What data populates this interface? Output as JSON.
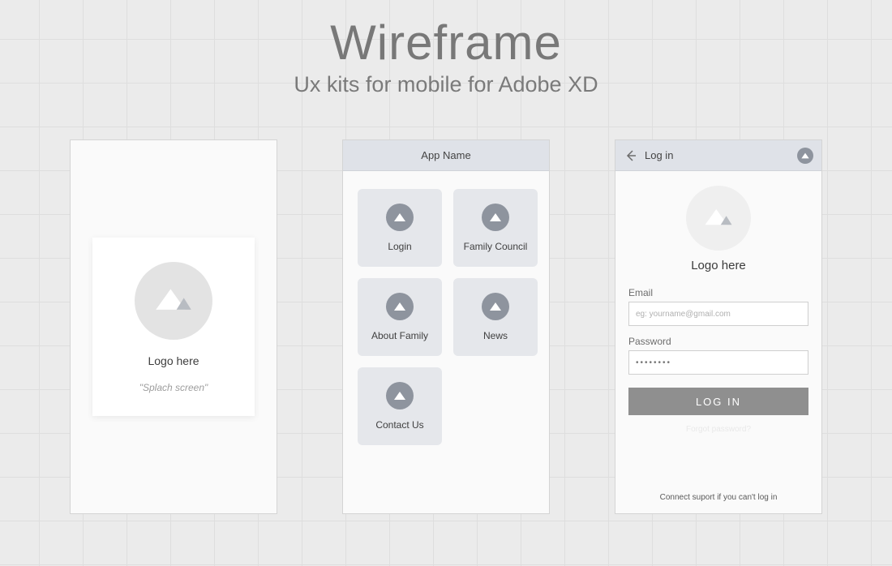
{
  "header": {
    "title": "Wireframe",
    "subtitle": "Ux kits for mobile for Adobe XD"
  },
  "screen1": {
    "logo_label": "Logo here",
    "caption": "\"Splach screen\""
  },
  "screen2": {
    "appbar_title": "App Name",
    "tiles": [
      {
        "label": "Login"
      },
      {
        "label": "Family Council"
      },
      {
        "label": "About Family"
      },
      {
        "label": "News"
      },
      {
        "label": "Contact Us"
      }
    ]
  },
  "screen3": {
    "appbar_title": "Log in",
    "logo_label": "Logo here",
    "email_label": "Email",
    "email_placeholder": "eg: yourname@gmail.com",
    "password_label": "Password",
    "password_value": "••••••••",
    "login_button": "LOG IN",
    "forgot_text": "Forgot password?",
    "support_text": "Connect suport if you can't log in"
  }
}
